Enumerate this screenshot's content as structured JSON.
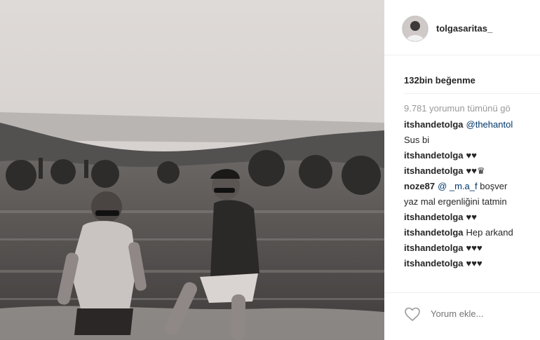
{
  "post": {
    "username": "tolgasaritas_",
    "likes": "132bin beğenme",
    "view_all": "9.781 yorumun tümünü gö",
    "comments": [
      {
        "user": "itshandetolga",
        "mention": "@thehantol",
        "text": ""
      },
      {
        "user": "",
        "mention": "",
        "text": "Sus bi"
      },
      {
        "user": "itshandetolga",
        "mention": "",
        "text": "♥♥"
      },
      {
        "user": "itshandetolga",
        "mention": "",
        "text": "♥♥♛"
      },
      {
        "user": "noze87",
        "mention": "@ _m.a_f",
        "text": "boşver"
      },
      {
        "user": "",
        "mention": "",
        "text": "yaz mal ergenliğini tatmin"
      },
      {
        "user": "itshandetolga",
        "mention": "",
        "text": "♥♥"
      },
      {
        "user": "itshandetolga",
        "mention": "",
        "text": "Hep arkand"
      },
      {
        "user": "itshandetolga",
        "mention": "",
        "text": "♥♥♥"
      },
      {
        "user": "itshandetolga",
        "mention": "",
        "text": "♥♥♥"
      }
    ],
    "add_comment_placeholder": "Yorum ekle..."
  },
  "icons": {
    "like": "heart-outline-icon",
    "avatar": "profile-avatar"
  },
  "colors": {
    "username": "#262626",
    "secondary": "#999999",
    "mention": "#003569",
    "divider": "#efefef"
  }
}
